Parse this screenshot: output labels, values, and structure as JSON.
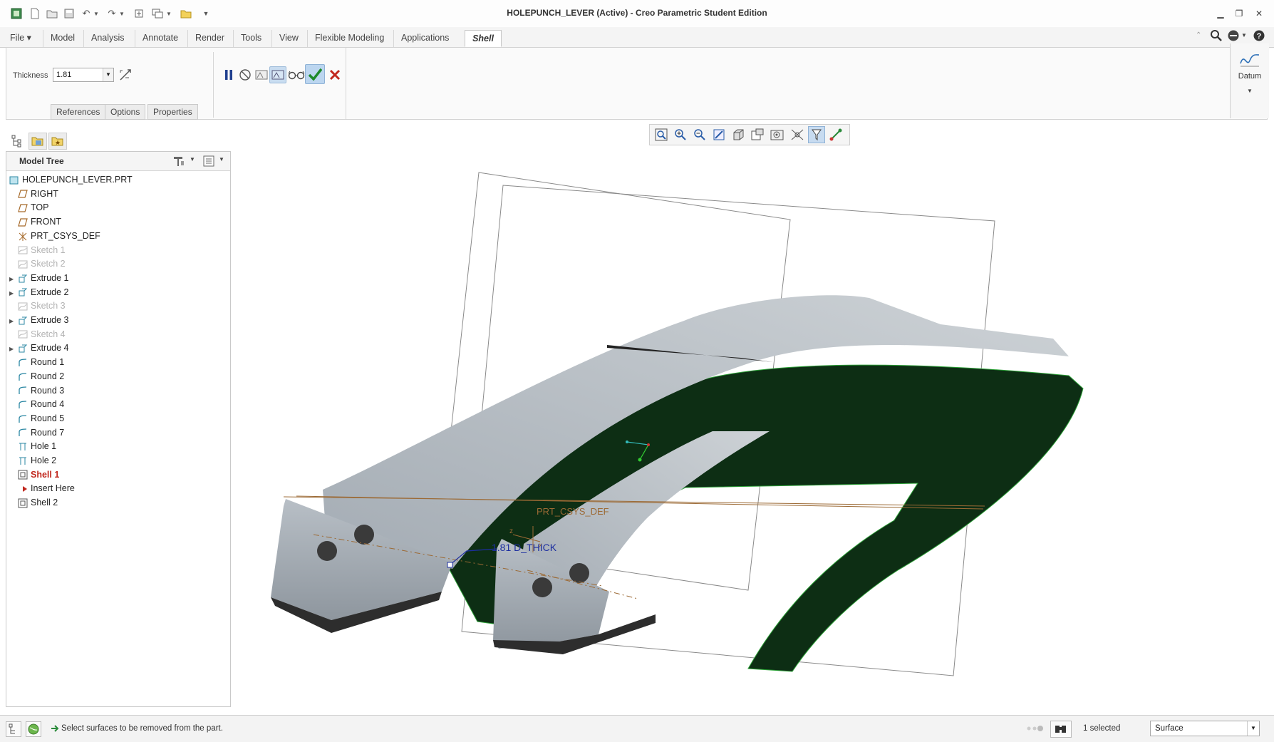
{
  "window": {
    "title": "HOLEPUNCH_LEVER (Active) - Creo Parametric Student Edition"
  },
  "ribbon": {
    "tabs": [
      "File",
      "Model",
      "Analysis",
      "Annotate",
      "Render",
      "Tools",
      "View",
      "Flexible Modeling",
      "Applications",
      "Shell"
    ],
    "active_tab": "Shell",
    "datum_label": "Datum"
  },
  "shell_dashboard": {
    "thickness_label": "Thickness",
    "thickness_value": "1.81",
    "subtabs": [
      "References",
      "Options",
      "Properties"
    ]
  },
  "model_tree": {
    "header": "Model Tree",
    "root": "HOLEPUNCH_LEVER.PRT",
    "items": [
      {
        "label": "RIGHT",
        "icon": "datum-plane-icon",
        "state": "normal",
        "expandable": false
      },
      {
        "label": "TOP",
        "icon": "datum-plane-icon",
        "state": "normal",
        "expandable": false
      },
      {
        "label": "FRONT",
        "icon": "datum-plane-icon",
        "state": "normal",
        "expandable": false
      },
      {
        "label": "PRT_CSYS_DEF",
        "icon": "csys-icon",
        "state": "normal",
        "expandable": false
      },
      {
        "label": "Sketch 1",
        "icon": "sketch-icon",
        "state": "dimmed",
        "expandable": false
      },
      {
        "label": "Sketch 2",
        "icon": "sketch-icon",
        "state": "dimmed",
        "expandable": false
      },
      {
        "label": "Extrude 1",
        "icon": "extrude-icon",
        "state": "normal",
        "expandable": true
      },
      {
        "label": "Extrude 2",
        "icon": "extrude-icon",
        "state": "normal",
        "expandable": true
      },
      {
        "label": "Sketch 3",
        "icon": "sketch-icon",
        "state": "dimmed",
        "expandable": false
      },
      {
        "label": "Extrude 3",
        "icon": "extrude-icon",
        "state": "normal",
        "expandable": true
      },
      {
        "label": "Sketch 4",
        "icon": "sketch-icon",
        "state": "dimmed",
        "expandable": false
      },
      {
        "label": "Extrude 4",
        "icon": "extrude-icon",
        "state": "normal",
        "expandable": true
      },
      {
        "label": "Round 1",
        "icon": "round-icon",
        "state": "normal",
        "expandable": false
      },
      {
        "label": "Round 2",
        "icon": "round-icon",
        "state": "normal",
        "expandable": false
      },
      {
        "label": "Round 3",
        "icon": "round-icon",
        "state": "normal",
        "expandable": false
      },
      {
        "label": "Round 4",
        "icon": "round-icon",
        "state": "normal",
        "expandable": false
      },
      {
        "label": "Round 5",
        "icon": "round-icon",
        "state": "normal",
        "expandable": false
      },
      {
        "label": "Round 7",
        "icon": "round-icon",
        "state": "normal",
        "expandable": false
      },
      {
        "label": "Hole 1",
        "icon": "hole-icon",
        "state": "normal",
        "expandable": false
      },
      {
        "label": "Hole 2",
        "icon": "hole-icon",
        "state": "normal",
        "expandable": false
      },
      {
        "label": "Shell 1",
        "icon": "shell-icon",
        "state": "active",
        "expandable": false
      },
      {
        "label": "Insert Here",
        "icon": "insert-arrow-icon",
        "state": "insert",
        "expandable": false
      },
      {
        "label": "Shell 2",
        "icon": "shell-icon",
        "state": "normal",
        "expandable": false
      }
    ]
  },
  "graphics": {
    "csys_label": "PRT_CSYS_DEF",
    "dimension_label": "1.81 D_THICK",
    "part_color": "#0e2f14",
    "body_color": "#9aa3ab"
  },
  "status": {
    "message": "Select surfaces to be removed from the part.",
    "selected_count": "1 selected",
    "filter_value": "Surface"
  }
}
